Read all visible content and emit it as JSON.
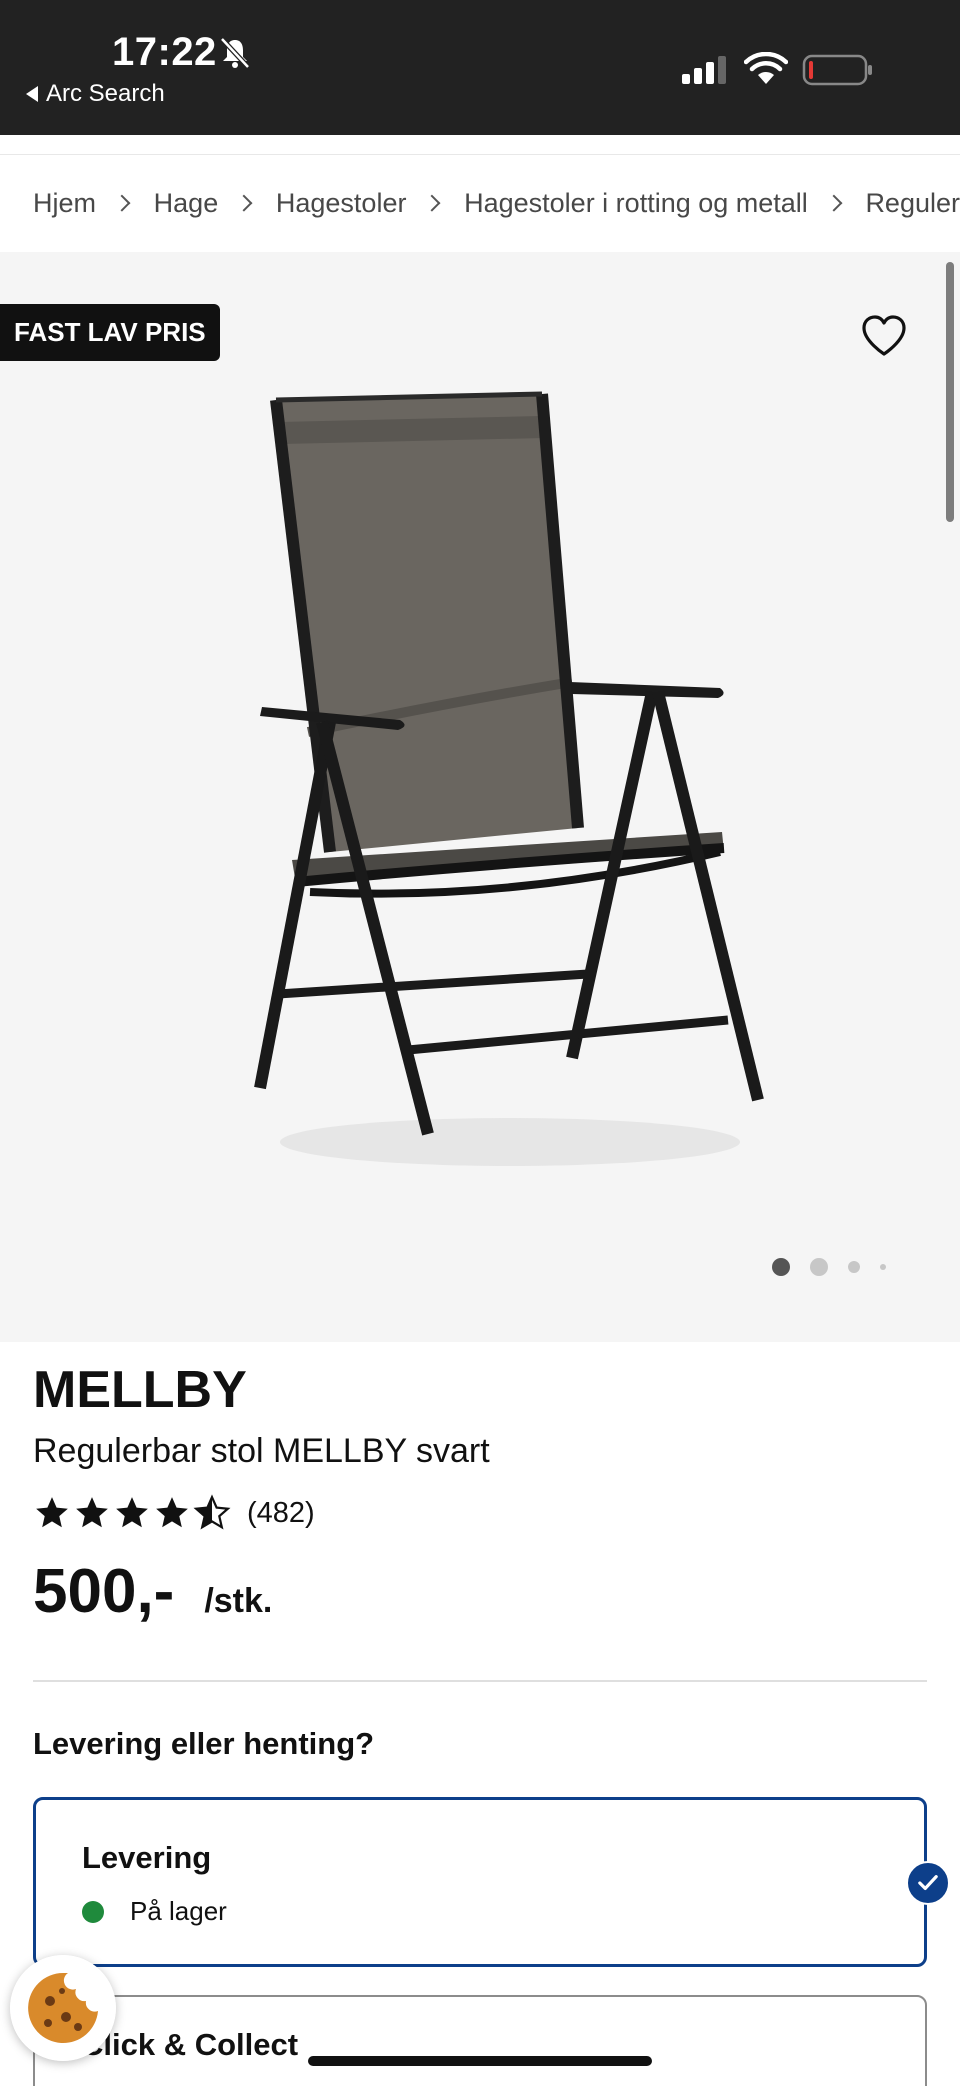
{
  "status_bar": {
    "time": "17:22",
    "back_app": "Arc Search",
    "icons": [
      "bell-slash-icon",
      "signal-icon",
      "wifi-icon",
      "battery-icon"
    ]
  },
  "breadcrumb": [
    "Hjem",
    "Hage",
    "Hagestoler",
    "Hagestoler i rotting og metall",
    "Reguler"
  ],
  "gallery": {
    "badge": "FAST LAV PRIS",
    "image_count": 4,
    "active_index": 0,
    "favorite_icon": "heart-outline-icon"
  },
  "product": {
    "name": "MELLBY",
    "description": "Regulerbar stol MELLBY svart",
    "rating": 4.5,
    "rating_count": "(482)",
    "price": "500,-",
    "unit": "/stk."
  },
  "delivery": {
    "question": "Levering eller henting?",
    "options": [
      {
        "title": "Levering",
        "status": "På lager",
        "selected": true
      },
      {
        "title": "Click & Collect",
        "selected": false
      }
    ]
  },
  "colors": {
    "accent": "#0d3f8a",
    "in_stock": "#1f8a3c",
    "status_bar": "#222222",
    "gallery_bg": "#f5f5f5"
  }
}
